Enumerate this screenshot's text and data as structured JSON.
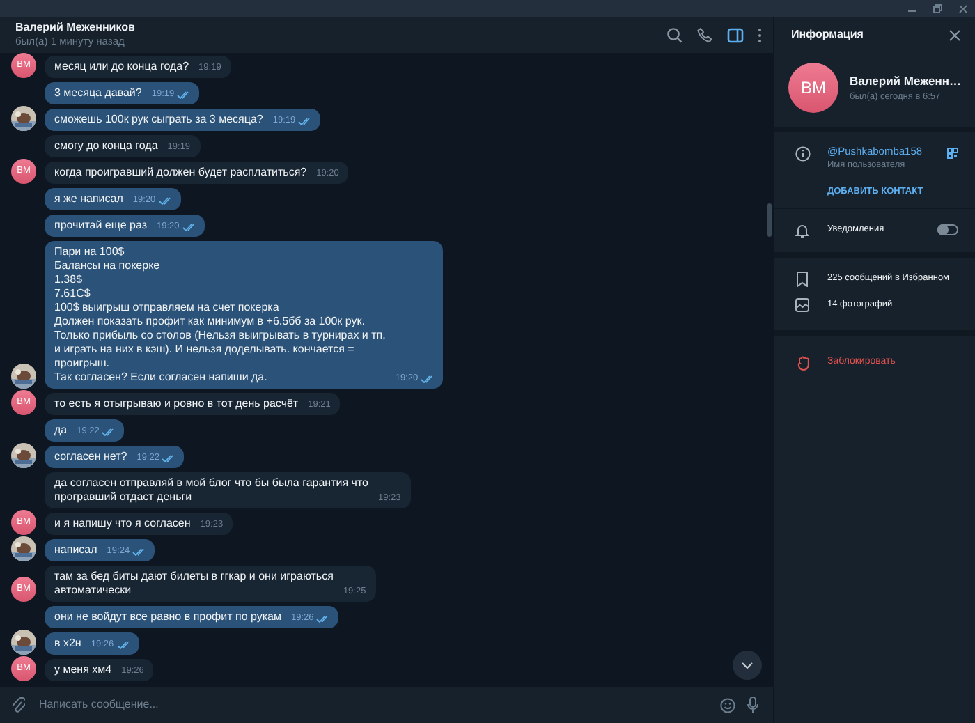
{
  "chat_header": {
    "name": "Валерий Меженников",
    "status": "был(а) 1 минуту назад",
    "info_toggle_active": true
  },
  "messages": [
    {
      "outgoing": false,
      "text": "месяц или до конца года?",
      "time": "19:19",
      "avatar": {
        "kind": "initials",
        "text": "ВМ"
      }
    },
    {
      "outgoing": true,
      "text": "3 месяца давай?",
      "time": "19:19",
      "read": true
    },
    {
      "outgoing": true,
      "text": "сможешь 100к рук сыграть за 3 месяца?",
      "time": "19:19",
      "read": true
    },
    {
      "outgoing": false,
      "text": "смогу до конца года",
      "time": "19:19"
    },
    {
      "outgoing": false,
      "text": "когда проигравший должен будет расплатиться?",
      "time": "19:20",
      "avatar": {
        "kind": "initials",
        "text": "ВМ"
      }
    },
    {
      "outgoing": true,
      "text": "я же написал",
      "time": "19:20",
      "read": true
    },
    {
      "outgoing": true,
      "text": "прочитай еще раз",
      "time": "19:20",
      "read": true
    },
    {
      "outgoing": true,
      "text": "Пари на 100$\nБалансы на покерке\n1.38$\n7.61C$\n100$ выигрыш отправляем на счет покерка\nДолжен показать профит как минимум в +6.5бб за 100к рук.\nТолько прибыль со столов (Нельзя выигрывать в турнирах и тп,\nи играть на них в кэш). И нельзя доделывать. кончается =\nпроигрыш.\nТак согласен? Если согласен напиши да.",
      "time": "19:20",
      "read": true
    },
    {
      "outgoing": false,
      "text": "то есть я отыгрываю и ровно в тот день расчёт",
      "time": "19:21",
      "avatar": {
        "kind": "initials",
        "text": "ВМ"
      }
    },
    {
      "outgoing": true,
      "text": "да",
      "time": "19:22",
      "read": true
    },
    {
      "outgoing": true,
      "text": "согласен нет?",
      "time": "19:22",
      "read": true
    },
    {
      "outgoing": false,
      "text": "да согласен отправляй в мой блог что бы была гарантия что\nпрогравший отдаст деньги",
      "time": "19:23"
    },
    {
      "outgoing": false,
      "text": "и я напишу что я согласен",
      "time": "19:23",
      "avatar": {
        "kind": "initials",
        "text": "ВМ"
      }
    },
    {
      "outgoing": true,
      "text": "написал",
      "time": "19:24",
      "read": true
    },
    {
      "outgoing": false,
      "text": "там за бед биты дают билеты в ггкар и они играються\nавтоматически",
      "time": "19:25",
      "avatar": {
        "kind": "initials",
        "text": "ВМ"
      }
    },
    {
      "outgoing": true,
      "text": "они не войдут все равно в профит по рукам",
      "time": "19:26",
      "read": true
    },
    {
      "outgoing": true,
      "text": "в х2н",
      "time": "19:26",
      "read": true
    },
    {
      "outgoing": false,
      "text": "у меня хм4",
      "time": "19:26",
      "avatar": {
        "kind": "initials",
        "text": "ВМ"
      }
    }
  ],
  "composer": {
    "placeholder": "Написать сообщение..."
  },
  "info_panel": {
    "title": "Информация",
    "initials": "ВМ",
    "name": "Валерий Меженн…",
    "status": "был(а) сегодня в 6:57",
    "username": "@Pushkabomba158",
    "username_label": "Имя пользователя",
    "add_contact": "ДОБАВИТЬ КОНТАКТ",
    "notifications": {
      "label": "Уведомления",
      "on": false
    },
    "saved": "225 сообщений в Избранном",
    "photos": "14 фотографий",
    "block": "Заблокировать"
  }
}
